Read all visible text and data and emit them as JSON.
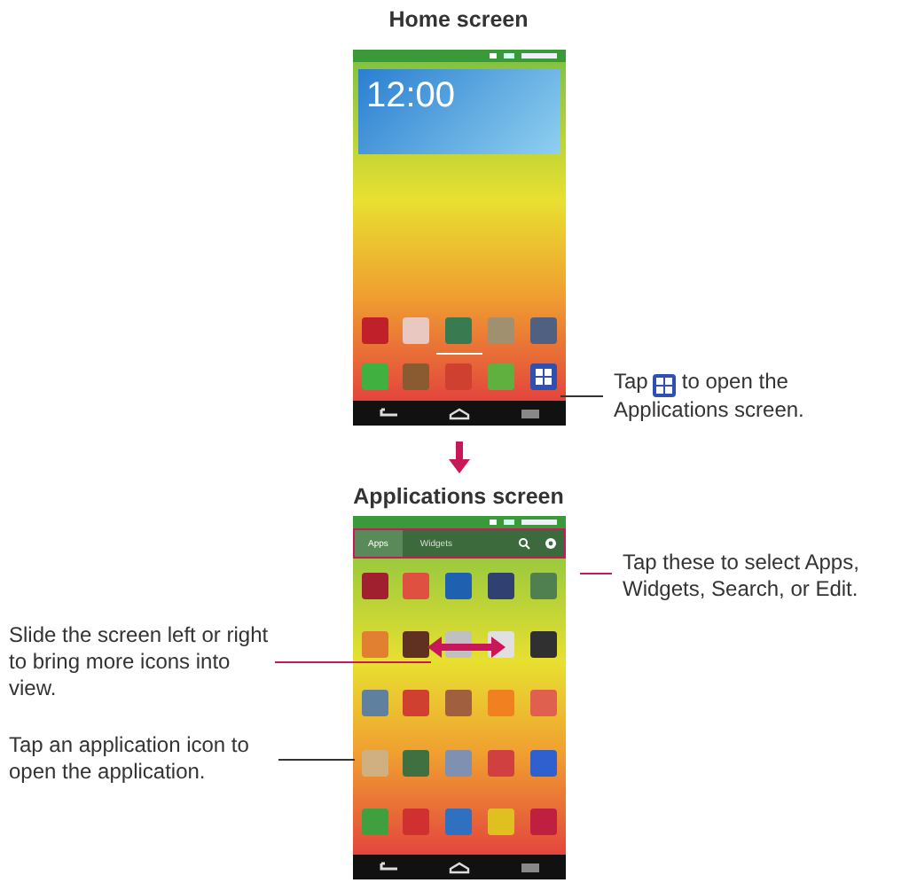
{
  "home": {
    "title": "Home screen",
    "clock": "12:00",
    "row": [
      {
        "kind": "app",
        "color": "#c0202a"
      },
      {
        "kind": "app",
        "color": "#e8c8c0"
      },
      {
        "kind": "app",
        "color": "#3a7a50"
      },
      {
        "kind": "app",
        "color": "#a09070"
      },
      {
        "kind": "app",
        "color": "#506080"
      }
    ],
    "dock": [
      {
        "kind": "app",
        "color": "#40b040"
      },
      {
        "kind": "app",
        "color": "#8a5a30"
      },
      {
        "kind": "app",
        "color": "#d04030"
      },
      {
        "kind": "app",
        "color": "#60b040"
      },
      {
        "kind": "grid",
        "color": "#3050b0"
      }
    ]
  },
  "apps": {
    "title": "Applications screen",
    "tabs": [
      {
        "label": "Apps",
        "selected": true
      },
      {
        "label": "Widgets",
        "selected": false
      }
    ],
    "icons": [
      {
        "kind": "app",
        "color": "#a02030"
      },
      {
        "kind": "app",
        "color": "#e05040"
      },
      {
        "kind": "app",
        "color": "#2060b0"
      },
      {
        "kind": "app",
        "color": "#304070"
      },
      {
        "kind": "app",
        "color": "#508050"
      },
      {
        "kind": "app",
        "color": "#e08030"
      },
      {
        "kind": "app",
        "color": "#603020"
      },
      {
        "kind": "app",
        "color": "#c0c0c0"
      },
      {
        "kind": "app",
        "color": "#e0e0e0"
      },
      {
        "kind": "app",
        "color": "#303030"
      },
      {
        "kind": "app",
        "color": "#6080a0"
      },
      {
        "kind": "app",
        "color": "#d04030"
      },
      {
        "kind": "app",
        "color": "#a06040"
      },
      {
        "kind": "app",
        "color": "#f08020"
      },
      {
        "kind": "app",
        "color": "#e06050"
      },
      {
        "kind": "app",
        "color": "#d0b080"
      },
      {
        "kind": "app",
        "color": "#407040"
      },
      {
        "kind": "app",
        "color": "#8090b0"
      },
      {
        "kind": "app",
        "color": "#d04040"
      },
      {
        "kind": "app",
        "color": "#3060d0"
      },
      {
        "kind": "app",
        "color": "#40a040"
      },
      {
        "kind": "app",
        "color": "#d03030"
      },
      {
        "kind": "app",
        "color": "#3070c0"
      },
      {
        "kind": "app",
        "color": "#e0c020"
      },
      {
        "kind": "app",
        "color": "#c02040"
      }
    ]
  },
  "callouts": {
    "apps_button": {
      "before": "Tap",
      "after": "to open the Applications screen."
    },
    "tabs": "Tap these to select Apps, Widgets, Search, or Edit.",
    "slide": "Slide the screen left or right to bring more icons into view.",
    "tap_icon": "Tap an application icon to open the application."
  }
}
